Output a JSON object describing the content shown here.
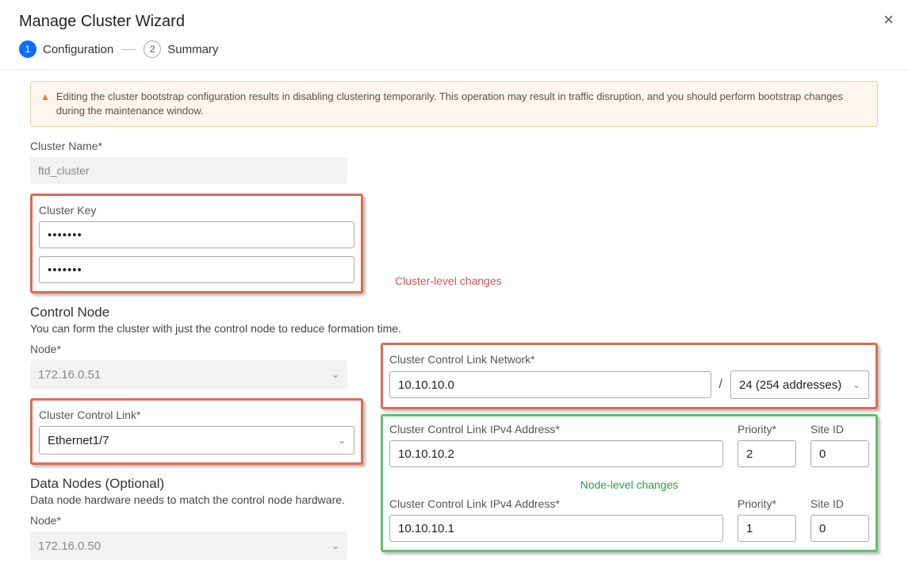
{
  "header": {
    "title": "Manage Cluster Wizard",
    "step1_label": "Configuration",
    "step2_label": "Summary",
    "step1_num": "1",
    "step2_num": "2"
  },
  "warning": "Editing the cluster bootstrap configuration results in disabling clustering temporarily. This operation may result in traffic disruption, and you should perform bootstrap changes during the maintenance window.",
  "cluster_name": {
    "label": "Cluster Name*",
    "value": "ftd_cluster"
  },
  "cluster_key": {
    "label": "Cluster Key",
    "value1": "•••••••",
    "value2": "•••••••"
  },
  "annotations": {
    "cluster_level": "Cluster-level changes",
    "node_level": "Node-level changes"
  },
  "control_node": {
    "title": "Control Node",
    "desc": "You can form the cluster with just the control node to reduce formation time.",
    "node_label": "Node*",
    "node_value": "172.16.0.51",
    "ccl_label": "Cluster Control Link*",
    "ccl_value": "Ethernet1/7",
    "ccl_net_label": "Cluster Control Link Network*",
    "ccl_net_value": "10.10.10.0",
    "ccl_net_mask": "24 (254 addresses)",
    "ccl_ip_label": "Cluster Control Link IPv4 Address*",
    "ccl_ip_value": "10.10.10.2",
    "priority_label": "Priority*",
    "priority_value": "2",
    "siteid_label": "Site ID",
    "siteid_value": "0"
  },
  "data_nodes": {
    "title": "Data Nodes (Optional)",
    "desc": "Data node hardware needs to match the control node hardware.",
    "node_label": "Node*",
    "node_value": "172.16.0.50",
    "ccl_ip_label": "Cluster Control Link IPv4 Address*",
    "ccl_ip_value": "10.10.10.1",
    "priority_label": "Priority*",
    "priority_value": "1",
    "siteid_label": "Site ID",
    "siteid_value": "0"
  }
}
